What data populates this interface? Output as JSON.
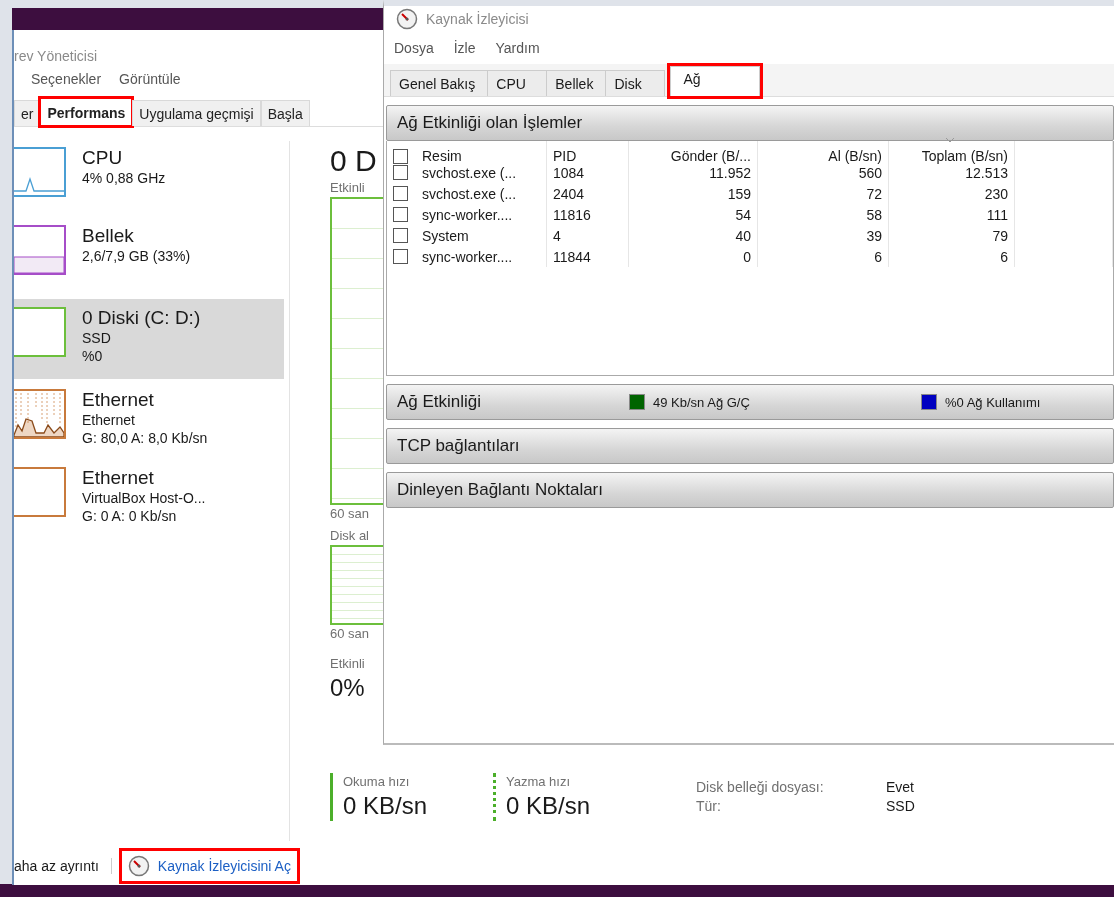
{
  "task_manager": {
    "title": "rev Yöneticisi",
    "menu": [
      "Seçenekler",
      "Görüntüle"
    ],
    "tabs": [
      {
        "label": "er",
        "selected": false,
        "highlighted": false
      },
      {
        "label": "Performans",
        "selected": true,
        "highlighted": true
      },
      {
        "label": "Uygulama geçmişi",
        "selected": false,
        "highlighted": false
      },
      {
        "label": "Başla",
        "selected": false,
        "highlighted": false
      }
    ],
    "sidebar": {
      "items": [
        {
          "kind": "cpu",
          "title": "CPU",
          "lines": [
            "4% 0,88 GHz"
          ],
          "color": "#4a9fd4",
          "selected": false
        },
        {
          "kind": "memory",
          "title": "Bellek",
          "lines": [
            "2,6/7,9 GB (33%)"
          ],
          "color": "#a64dc8",
          "selected": false
        },
        {
          "kind": "empty",
          "title": "0 Diski (C: D:)",
          "lines": [
            "SSD",
            "%0"
          ],
          "color": "#6cbf3c",
          "selected": true
        },
        {
          "kind": "network",
          "title": "Ethernet",
          "lines": [
            "Ethernet",
            "G: 80,0 A: 8,0 Kb/sn"
          ],
          "color": "#c87a3c",
          "selected": false
        },
        {
          "kind": "empty",
          "title": "Ethernet",
          "lines": [
            "VirtualBox Host-O...",
            "G: 0 A: 0 Kb/sn"
          ],
          "color": "#c87a3c",
          "selected": false
        }
      ]
    },
    "main": {
      "heading": "0 D",
      "graph_label": "Etkinli",
      "graph_time": "60 san",
      "graph2_label": "Disk al",
      "graph2_time": "60 san",
      "activity_label": "Etkinli",
      "activity_value": "0%",
      "speeds": [
        {
          "kind": "solid",
          "label": "Okuma hızı",
          "value": "0 KB/sn"
        },
        {
          "kind": "dotted",
          "label": "Yazma hızı",
          "value": "0 KB/sn"
        }
      ],
      "properties": [
        {
          "label": "Disk belleği dosyası:",
          "value": "Evet"
        },
        {
          "label": "Tür:",
          "value": "SSD"
        }
      ]
    },
    "footer": {
      "less_details": "aha az ayrıntı",
      "link": {
        "label": "Kaynak İzleyicisini Aç",
        "highlighted": true
      }
    }
  },
  "resource_monitor": {
    "title": "Kaynak İzleyicisi",
    "menu": [
      "Dosya",
      "İzle",
      "Yardım"
    ],
    "tabs": [
      {
        "label": "Genel Bakış",
        "selected": false,
        "highlighted": false
      },
      {
        "label": "CPU",
        "selected": false,
        "highlighted": false
      },
      {
        "label": "Bellek",
        "selected": false,
        "highlighted": false
      },
      {
        "label": "Disk",
        "selected": false,
        "highlighted": false
      },
      {
        "label": "Ağ",
        "selected": true,
        "highlighted": true
      }
    ],
    "processes": {
      "title": "Ağ Etkinliği olan İşlemler",
      "select_all_checked": false,
      "columns": [
        "Resim",
        "PID",
        "Gönder (B/...",
        "Al (B/sn)",
        "Toplam (B/sn)"
      ],
      "rows": [
        {
          "checked": false,
          "cells": [
            "svchost.exe (...",
            "1084",
            "11.952",
            "560",
            "12.513"
          ]
        },
        {
          "checked": false,
          "cells": [
            "svchost.exe (...",
            "2404",
            "159",
            "72",
            "230"
          ]
        },
        {
          "checked": false,
          "cells": [
            "sync-worker....",
            "11816",
            "54",
            "58",
            "111"
          ]
        },
        {
          "checked": false,
          "cells": [
            "System",
            "4",
            "40",
            "39",
            "79"
          ]
        },
        {
          "checked": false,
          "cells": [
            "sync-worker....",
            "11844",
            "0",
            "6",
            "6"
          ]
        }
      ]
    },
    "sections": [
      {
        "title": "Ağ Etkinliği",
        "legend": [
          {
            "label": "49 Kb/sn Ağ G/Ç",
            "color": "#006400"
          },
          {
            "label": "%0 Ağ Kullanımı",
            "color": "#0000c0"
          }
        ]
      },
      {
        "title": "TCP bağlantıları"
      },
      {
        "title": "Dinleyen Bağlantı Noktaları"
      }
    ]
  }
}
